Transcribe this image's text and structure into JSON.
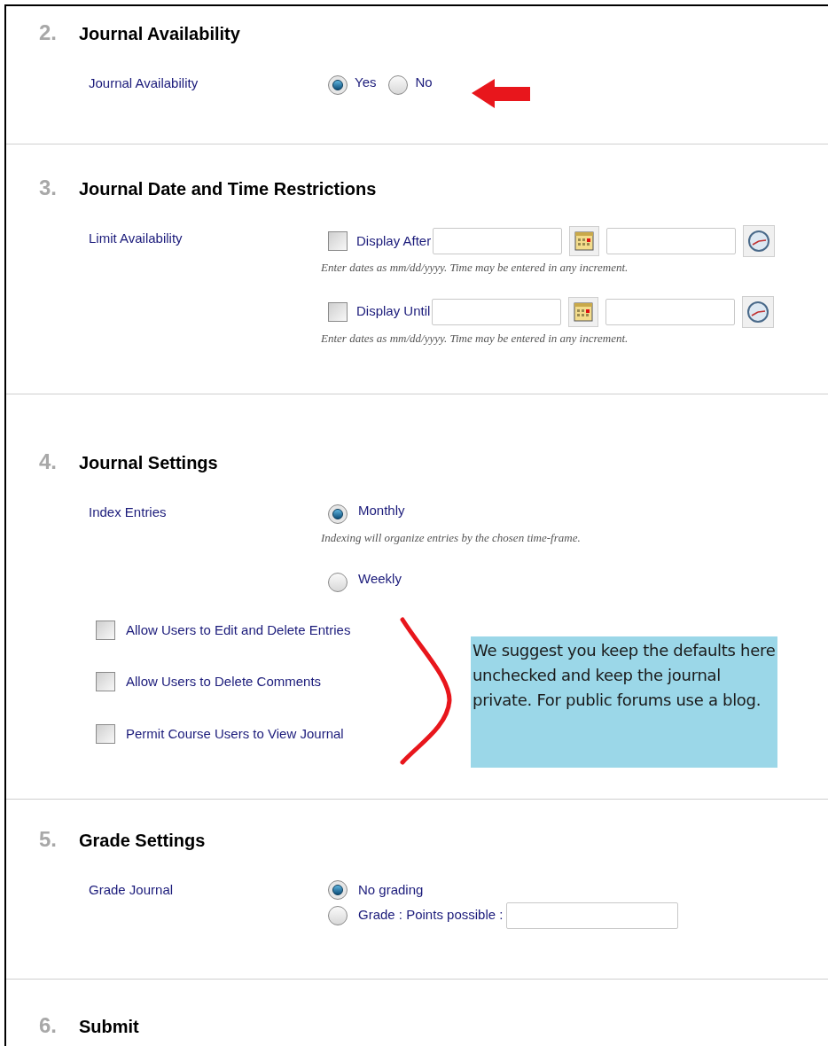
{
  "sections": [
    {
      "number": "2.",
      "title": "Journal Availability",
      "rows": [
        {
          "kind": "radio_inline",
          "label": "Journal Availability",
          "options": [
            {
              "label": "Yes",
              "selected": true
            },
            {
              "label": "No",
              "selected": false
            }
          ]
        }
      ]
    },
    {
      "number": "3.",
      "title": "Journal Date and Time Restrictions",
      "rows": [
        {
          "kind": "datetime",
          "label": "Limit Availability",
          "items": [
            {
              "label": "Display After",
              "checked": false,
              "hint": "Enter dates as mm/dd/yyyy. Time may be entered in any increment."
            },
            {
              "label": "Display Until",
              "checked": false,
              "hint": "Enter dates as mm/dd/yyyy. Time may be entered in any increment."
            }
          ]
        }
      ]
    },
    {
      "number": "4.",
      "title": "Journal Settings",
      "rows": [
        {
          "kind": "radio_stack",
          "label": "Index Entries",
          "options": [
            {
              "label": "Monthly",
              "selected": true,
              "hint": "Indexing will organize entries by the chosen time-frame."
            },
            {
              "label": "Weekly",
              "selected": false
            }
          ]
        },
        {
          "kind": "checkboxes",
          "items": [
            {
              "label": "Allow Users to Edit and Delete Entries",
              "checked": false
            },
            {
              "label": "Allow Users to Delete Comments",
              "checked": false
            },
            {
              "label": "Permit Course Users to View Journal",
              "checked": false
            }
          ]
        }
      ]
    },
    {
      "number": "5.",
      "title": "Grade Settings",
      "rows": [
        {
          "kind": "grade",
          "label": "Grade Journal",
          "options": [
            {
              "label": "No grading",
              "selected": true
            },
            {
              "label": "Grade : Points possible :",
              "selected": false
            }
          ]
        }
      ]
    },
    {
      "number": "6.",
      "title": "Submit"
    }
  ],
  "callout": {
    "text": "We suggest you keep the defaults here unchecked and keep the journal private.  For public forums use a blog."
  }
}
